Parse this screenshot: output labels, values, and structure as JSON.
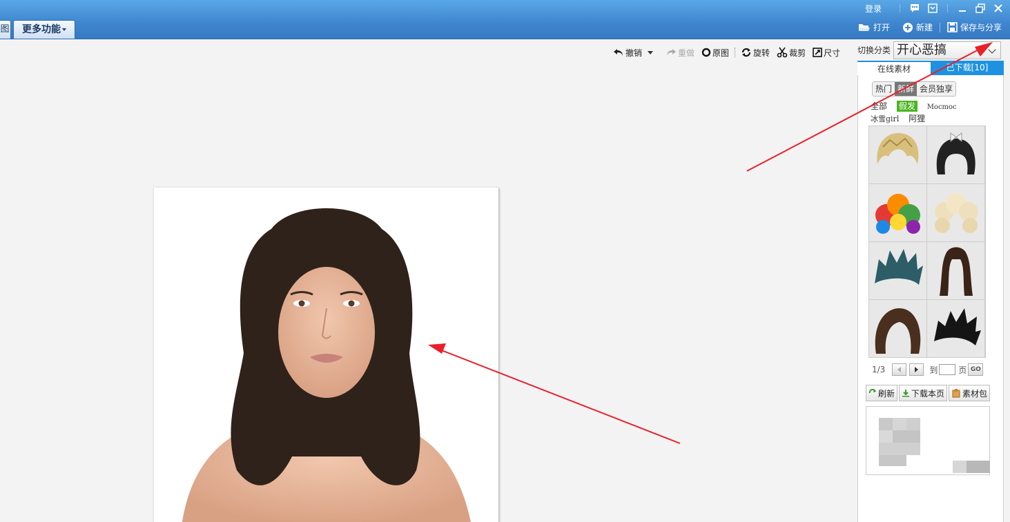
{
  "topbar": {
    "left_tab_fragment": "图",
    "more_features": "更多功能",
    "login": "登录",
    "actions": {
      "open": "打开",
      "new": "新建",
      "save_share": "保存与分享"
    }
  },
  "edit_toolbar": {
    "undo": "撤销",
    "redo": "重做",
    "original": "原图",
    "rotate": "旋转",
    "crop": "裁剪",
    "size": "尺寸"
  },
  "panel": {
    "category_label": "切换分类",
    "category_value": "开心恶搞",
    "tabs": [
      {
        "label": "在线素材",
        "active": true
      },
      {
        "label": "已下载[10]",
        "active": false
      }
    ],
    "segments": [
      {
        "label": "热门",
        "active": false
      },
      {
        "label": "新鲜",
        "active": true
      },
      {
        "label": "会员独享",
        "active": false
      }
    ],
    "filters": [
      "全部",
      "假发",
      "Mocmoc",
      "冰雪girl",
      "阿狸"
    ],
    "selected_filter": "假发",
    "thumbnails": [
      "blonde-short-wig",
      "black-bob-bow-wig",
      "rainbow-afro-wig",
      "cream-curly-wig",
      "teal-spiky-wig",
      "long-wavy-brown-wig",
      "brown-bob-wig",
      "black-spiky-wig"
    ],
    "pager": {
      "status": "1/3",
      "to_label": "到",
      "page_label": "页",
      "go": "GO"
    },
    "buttons": {
      "refresh": "刷新",
      "download_page": "下载本页",
      "package": "素材包"
    }
  },
  "colors": {
    "accent_blue": "#1e92e0",
    "titlebar": "#3f86cf",
    "arrow_red": "#e8202a",
    "filter_green": "#4ab51f"
  }
}
